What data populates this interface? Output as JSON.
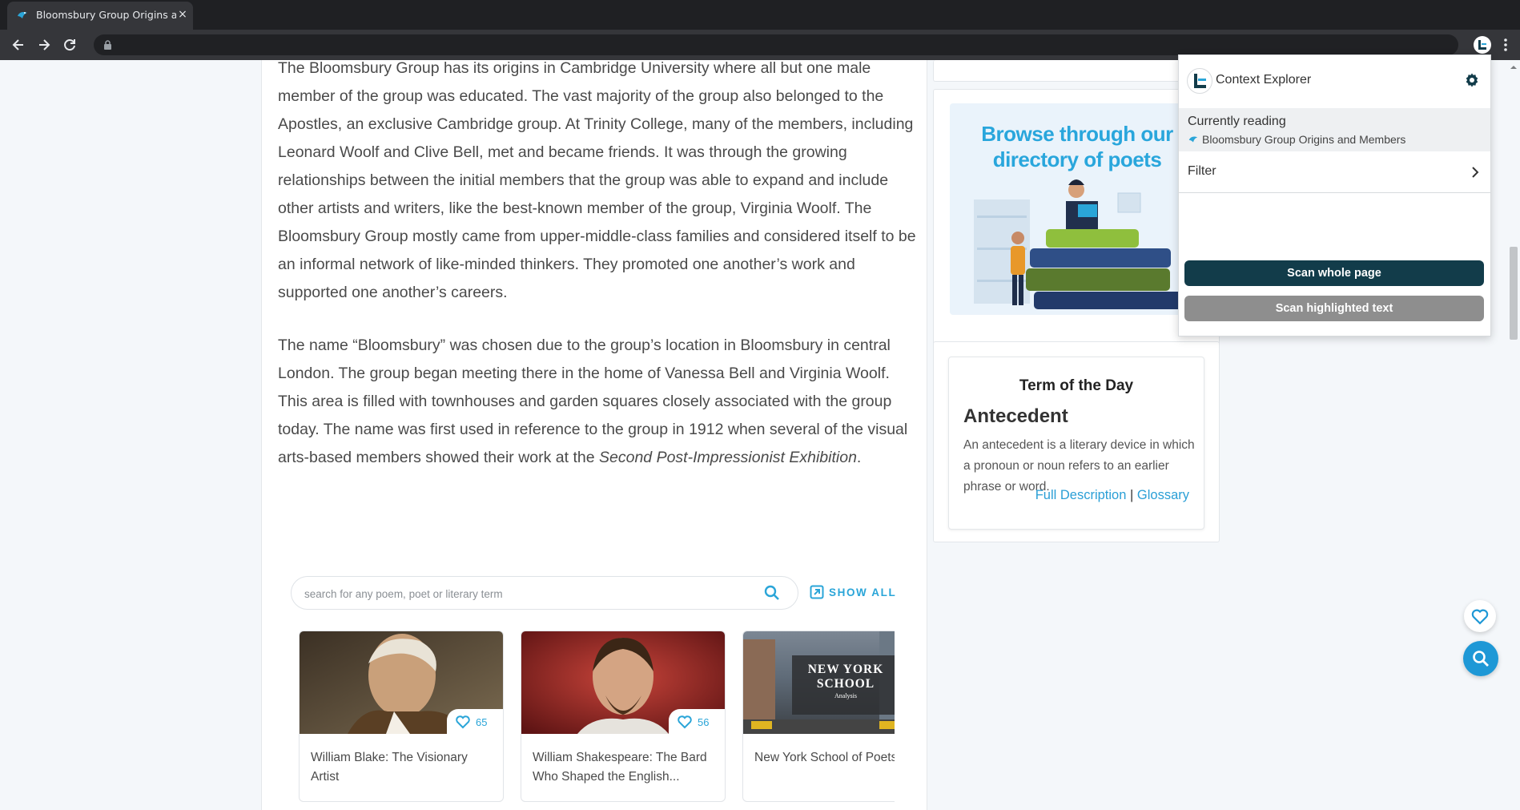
{
  "browser": {
    "tab_title": "Bloomsbury Group Origins and",
    "tab_close": "×"
  },
  "article": {
    "paragraph1": "The Bloomsbury Group has its origins in Cambridge University where all but one male member of the group was educated. The vast majority of the group also belonged to the Apostles, an exclusive Cambridge group. At Trinity College, many of the members, including Leonard Woolf and Clive Bell, met and became friends. It was through the growing relationships between the initial members that the group was able to expand and include other artists and writers, like the best-known member of the group, Virginia Woolf. The Bloomsbury Group mostly came from upper-middle-class families and considered itself to be an informal network of like-minded thinkers. They promoted one another’s work and supported one another’s careers.",
    "paragraph2_text": "The name “Bloomsbury” was chosen due to the group’s location in Bloomsbury in central London. The group began meeting there in the home of Vanessa Bell and Virginia Woolf. This area is filled with townhouses and garden squares closely associated with the group today. The name was first used in reference to the group in 1912 when several of the visual arts-based members showed their work at the ",
    "paragraph2_italic": "Second Post-Impressionist Exhibition",
    "paragraph2_end": "."
  },
  "search": {
    "placeholder": "search for any poem, poet or literary term",
    "show_all": "SHOW ALL"
  },
  "cards": [
    {
      "title": "William Blake: The Visionary Artist",
      "likes": "65"
    },
    {
      "title": "William Shakespeare: The Bard Who Shaped the English...",
      "likes": "56"
    },
    {
      "title": "New York School of Poets",
      "image_text_line1": "NEW YORK",
      "image_text_line2": "SCHOOL",
      "image_text_line3": "Analysis"
    }
  ],
  "sidebar": {
    "promo_line1": "Browse through our",
    "promo_line2": "directory of poets",
    "term_of_day": {
      "heading": "Term of the Day",
      "term": "Antecedent",
      "definition": "An antecedent is a literary device in which a pronoun or noun refers to an earlier phrase or word.",
      "link_full": "Full Description",
      "separator": "|",
      "link_glossary": "Glossary"
    }
  },
  "extension": {
    "title": "Context Explorer",
    "currently_reading_label": "Currently reading",
    "currently_reading_value": "Bloomsbury Group Origins and Members",
    "filter_label": "Filter",
    "scan_whole": "Scan whole page",
    "scan_highlighted": "Scan highlighted text",
    "colors": {
      "primary": "#123c4a",
      "disabled": "#8e8e8e"
    }
  },
  "colors": {
    "accent": "#2aa5d8",
    "fab_blue": "#1e98d6"
  }
}
